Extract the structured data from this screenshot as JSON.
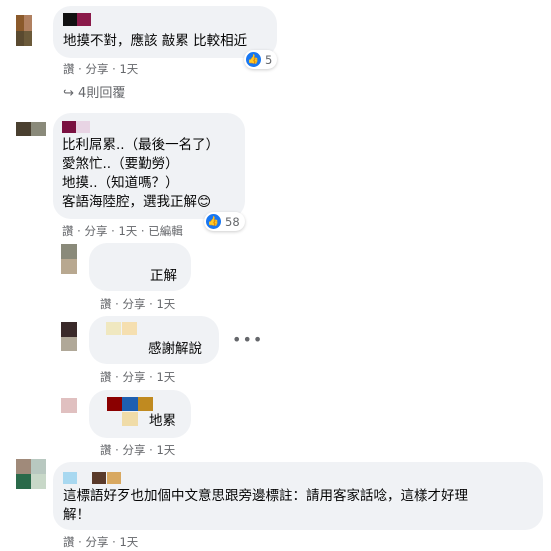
{
  "comments": [
    {
      "id": "c1",
      "avatar_colors": [
        "#8b5a2b",
        "#b68a5a",
        "#4a3a2a",
        "#6b5a3a"
      ],
      "name_colors": [
        "#111111",
        "#8a1a4a"
      ],
      "lines": [
        "地摸不對，應該 敲累 比較相近"
      ],
      "reaction_count": "5",
      "actions": {
        "like": "讚",
        "share": "分享",
        "time": "1天"
      },
      "replies_link": "4則回覆"
    },
    {
      "id": "c2",
      "avatar_colors": [
        "#4a4030",
        "#5a5040",
        "#8a8a7a",
        "#6a6a5a"
      ],
      "name_colors": [
        "#7a1040",
        "#e8d4e4"
      ],
      "lines": [
        "比利屌累..（最後一名了）",
        "愛煞忙..（要勤勞）",
        "地摸..（知道嗎？）",
        "客語海陸腔，選我正解😊"
      ],
      "reaction_count": "58",
      "actions": {
        "like": "讚",
        "share": "分享",
        "time": "1天",
        "edited": "已編輯"
      }
    },
    {
      "id": "r1",
      "avatar_colors": [
        "#8a8a7a",
        "#b8b0a0",
        "#a89a80",
        "#c0b8a8"
      ],
      "lines": [
        "正解"
      ],
      "actions": {
        "like": "讚",
        "share": "分享",
        "time": "1天"
      }
    },
    {
      "id": "r2",
      "avatar_colors": [
        "#3a2a2a",
        "#5a3a3a",
        "#b8b0a0",
        "#a8a090"
      ],
      "name_colors": [
        "#f0e8c0",
        "#f5dfb0"
      ],
      "lines": [
        "感謝解說"
      ],
      "actions": {
        "like": "讚",
        "share": "分享",
        "time": "1天"
      }
    },
    {
      "id": "r3",
      "avatar_colors": [
        "#e0c0c0",
        "#e8c8c8",
        "#e0c0c0",
        "#e8c8c8"
      ],
      "name_colors": [
        "#8b0000",
        "#1e5fb0",
        "#c08a20"
      ],
      "lines": [
        "地累"
      ],
      "actions": {
        "like": "讚",
        "share": "分享",
        "time": "1天"
      }
    },
    {
      "id": "c3",
      "avatar_colors": [
        "#a08a7a",
        "#6a8a8a",
        "#2a6a4a",
        "#c8d8c8"
      ],
      "name_colors": [
        "#a8d8f0",
        "#5a3a2a",
        "#d8a860"
      ],
      "lines": [
        "這標語好歹也加個中文意思跟旁邊標註：請用客家話唸，這樣才好理",
        "解！"
      ],
      "actions": {
        "like": "讚",
        "share": "分享",
        "time": "1天"
      }
    }
  ],
  "colors": {
    "bubble": "#f0f2f5",
    "accent": "#1877f2",
    "meta": "#65676b"
  },
  "icons": {
    "reply_arrow": "reply-arrow-icon",
    "like": "like-icon",
    "more": "more-options-icon"
  }
}
